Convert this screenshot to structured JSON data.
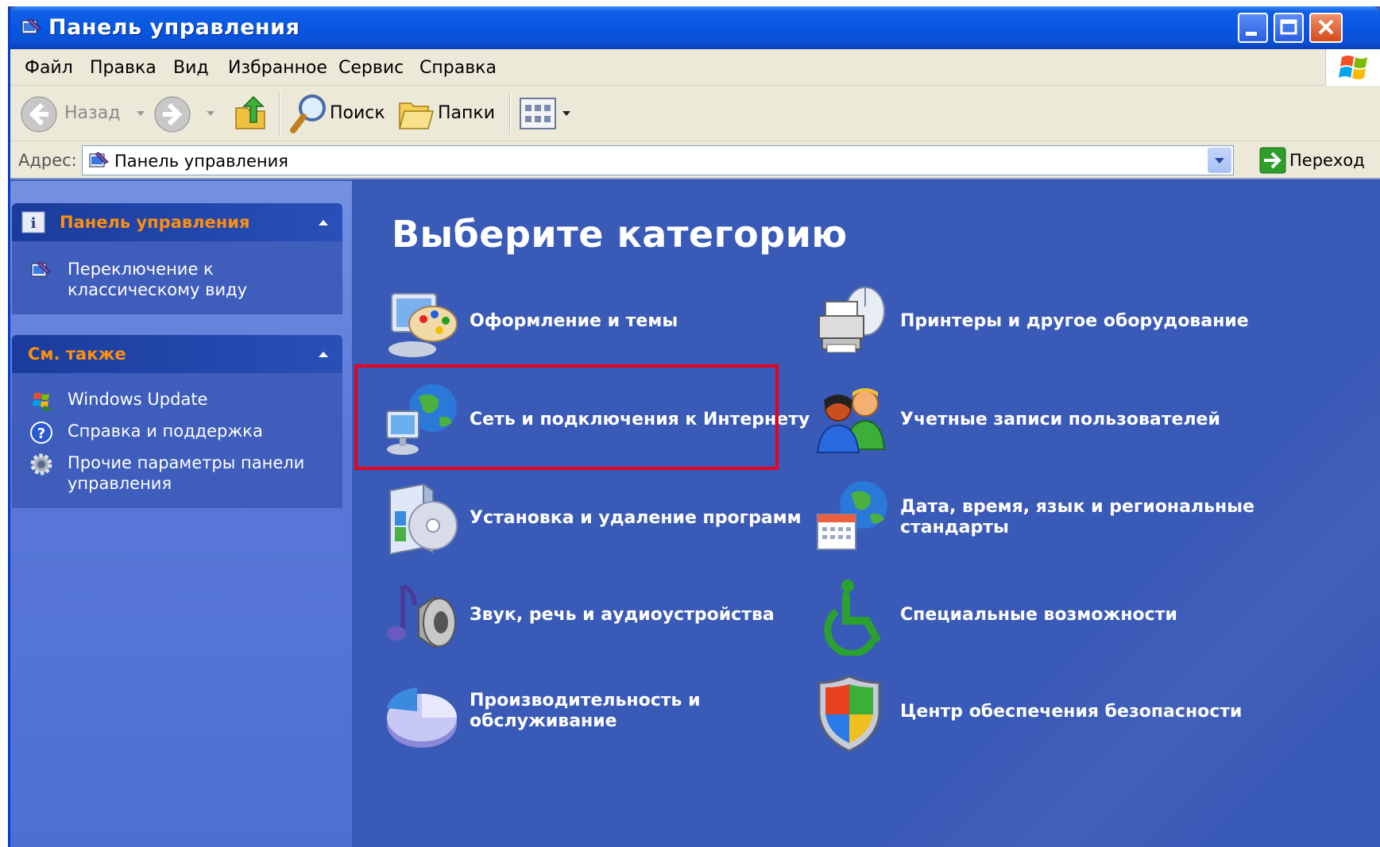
{
  "window": {
    "title": "Панель управления"
  },
  "menu": [
    "Файл",
    "Правка",
    "Вид",
    "Избранное",
    "Сервис",
    "Справка"
  ],
  "toolbar": {
    "back": "Назад",
    "search": "Поиск",
    "folders": "Папки"
  },
  "address": {
    "label": "Адрес:",
    "value": "Панель управления",
    "go": "Переход"
  },
  "sidebar": {
    "panel": {
      "title": "Панель управления",
      "items": [
        {
          "label_lines": [
            "Переключение к",
            "классическому виду"
          ]
        }
      ]
    },
    "see_also": {
      "title": "См. также",
      "items": [
        {
          "label": "Windows Update"
        },
        {
          "label": "Справка и поддержка"
        },
        {
          "label_lines": [
            "Прочие параметры панели",
            "управления"
          ]
        }
      ]
    }
  },
  "main": {
    "title": "Выберите категорию",
    "categories": [
      {
        "lines": [
          "Оформление и темы"
        ]
      },
      {
        "lines": [
          "Сеть и подключения к Интернету"
        ]
      },
      {
        "lines": [
          "Установка и удаление программ"
        ]
      },
      {
        "lines": [
          "Звук, речь и аудиоустройства"
        ]
      },
      {
        "lines": [
          "Производительность и",
          "обслуживание"
        ]
      },
      {
        "lines": [
          "Принтеры и другое оборудование"
        ]
      },
      {
        "lines": [
          "Учетные записи пользователей"
        ]
      },
      {
        "lines": [
          "Дата, время, язык и региональные",
          "стандарты"
        ]
      },
      {
        "lines": [
          "Специальные возможности"
        ]
      },
      {
        "lines": [
          "Центр обеспечения безопасности"
        ]
      }
    ]
  },
  "colors": {
    "main_bg": "#3a5ab7",
    "sidebar_head_text": "#fc8f12",
    "highlight": "#e8001c"
  }
}
